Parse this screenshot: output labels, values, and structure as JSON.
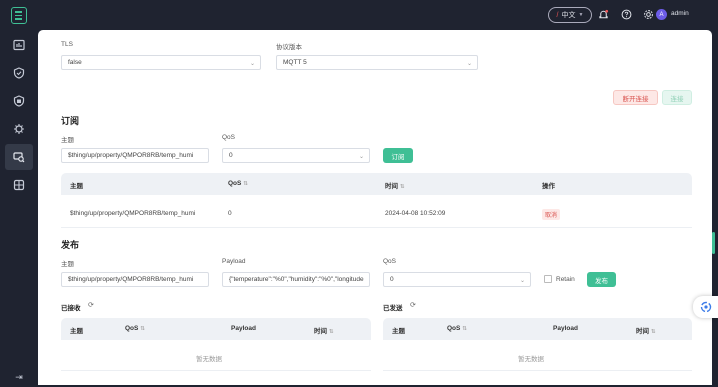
{
  "topbar": {
    "language": "中文",
    "user_initial": "A",
    "username": "admin"
  },
  "sidebar": {
    "items": [
      {
        "icon": "dashboard-icon"
      },
      {
        "icon": "shield-check-icon"
      },
      {
        "icon": "badge-icon"
      },
      {
        "icon": "gear-bug-icon"
      },
      {
        "icon": "client-debug-icon",
        "active": true
      },
      {
        "icon": "module-icon"
      }
    ],
    "collapse_icon": "collapse-arrows-icon"
  },
  "connection": {
    "tls_label": "TLS",
    "tls_value": "false",
    "protocol_label": "协议版本",
    "protocol_value": "MQTT 5",
    "disconnect_label": "断开连接",
    "connect_label": "连接"
  },
  "subscribe": {
    "section_title": "订阅",
    "topic_label": "主题",
    "topic_value": "$thing/up/property/QMPOR8RB/temp_humi",
    "qos_label": "QoS",
    "qos_value": "0",
    "button_label": "订阅",
    "table": {
      "headers": [
        "主题",
        "QoS",
        "时间",
        "操作"
      ],
      "rows": [
        {
          "topic": "$thing/up/property/QMPOR8RB/temp_humi",
          "qos": "0",
          "time": "2024-04-08 10:52:09",
          "action": "取消"
        }
      ]
    }
  },
  "publish": {
    "section_title": "发布",
    "topic_label": "主题",
    "topic_value": "$thing/up/property/QMPOR8RB/temp_humi",
    "payload_label": "Payload",
    "payload_value": "{\"temperature\":\"%0\",\"humidity\":\"%0\",\"longitude",
    "qos_label": "QoS",
    "qos_value": "0",
    "retain_label": "Retain",
    "button_label": "发布"
  },
  "received": {
    "title": "已接收",
    "headers": [
      "主题",
      "QoS",
      "Payload",
      "时间"
    ],
    "empty_text": "暂无数据"
  },
  "sent": {
    "title": "已发送",
    "headers": [
      "主题",
      "QoS",
      "Payload",
      "时间"
    ],
    "empty_text": "暂无数据"
  },
  "colors": {
    "accent": "#3fbf95",
    "danger": "#d9534f",
    "sidebar_bg": "#1f2330"
  }
}
